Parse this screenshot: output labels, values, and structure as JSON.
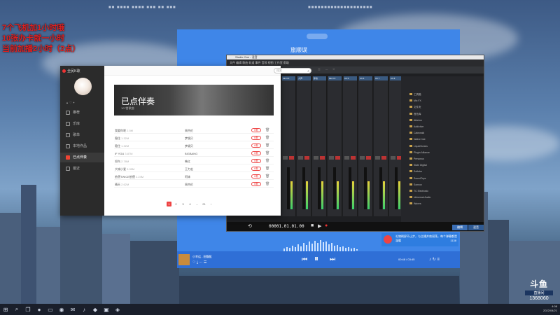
{
  "overlay": {
    "line1": "7个飞机加1小时哦",
    "line2": "10张办卡就一小时",
    "line3": "当前加播2小时（2点）"
  },
  "ticker": {
    "left": "■■ ■■■■ ■■■■ ■■■ ■■ ■■■",
    "right": "■■■■■■■■■■■■■■■■■■■■"
  },
  "music_app": {
    "app_name": "全民K歌",
    "user_stats": "▲  ♡  ✦",
    "nav": [
      {
        "label": "推荐"
      },
      {
        "label": "乐库"
      },
      {
        "label": "歌单"
      },
      {
        "label": "本地作品"
      },
      {
        "label": "已点伴奏"
      },
      {
        "label": "最近"
      }
    ],
    "search_placeholder": "搜索",
    "banner_title": "已点伴奏",
    "banner_subtitle": "107首歌曲",
    "songs": [
      {
        "name": "我要你呢",
        "size": "2.5M",
        "artist": "周杰伦"
      },
      {
        "name": "稳住",
        "size": "1.32M",
        "artist": "梦颖贝"
      },
      {
        "name": "稳住",
        "size": "1.32M",
        "artist": "梦颖贝"
      },
      {
        "name": "IF YOU",
        "size": "3.87M",
        "artist": "BIGBANG"
      },
      {
        "name": "如鸟",
        "size": "2.78M",
        "artist": "韩红"
      },
      {
        "name": "大城小爱",
        "size": "3.95M",
        "artist": "王力宏"
      },
      {
        "name": "依偎TWICE依偎",
        "size": "2.24M",
        "artist": "阿妹"
      },
      {
        "name": "晴天",
        "size": "2.62M",
        "artist": "周杰伦"
      }
    ],
    "sing_label": "K歌",
    "pages": [
      "1",
      "2",
      "3",
      "4",
      "…",
      "21",
      "›"
    ],
    "active_page": "1"
  },
  "player": {
    "title": "旅顺误",
    "song": "小幸运 - 田馥甄",
    "time": "00:48 / 03:45"
  },
  "daw": {
    "title": "Studio One - 混音",
    "menu": "文件  编辑  歌曲  轨道  事件  音频  视图  工作室  帮助",
    "channels": [
      "Mic FX",
      "人声",
      "伴奏",
      "Mic FX",
      "Ch 5",
      "Ch 6",
      "Ch 7",
      "Ch 8",
      "主输出",
      "Ch 10",
      "Ch 11"
    ],
    "time": "00001.01.01.00",
    "browser_items": [
      "工具箱",
      "Mix FX",
      "文件夹",
      "音色库",
      "Ableton",
      "Addictive",
      "Cakewalk",
      "Native Inst",
      "LiquidSonics",
      "Plugin Alliance",
      "Presonus",
      "Slate Digital",
      "Softube",
      "SoundToys",
      "Sonnox",
      "TC Electronic",
      "Universal Audio",
      "Waves"
    ],
    "bottom_buttons": [
      "编辑",
      "混音"
    ]
  },
  "notification": {
    "text": "礼物刷屏不止步，与主播并肩闯荡，每个弹幕都是温暖",
    "count": "1138"
  },
  "logo": {
    "brand": "斗鱼",
    "tag": "直播间",
    "room": "1368060"
  },
  "tray": {
    "time": "4:08",
    "date": "2022/04/21"
  }
}
